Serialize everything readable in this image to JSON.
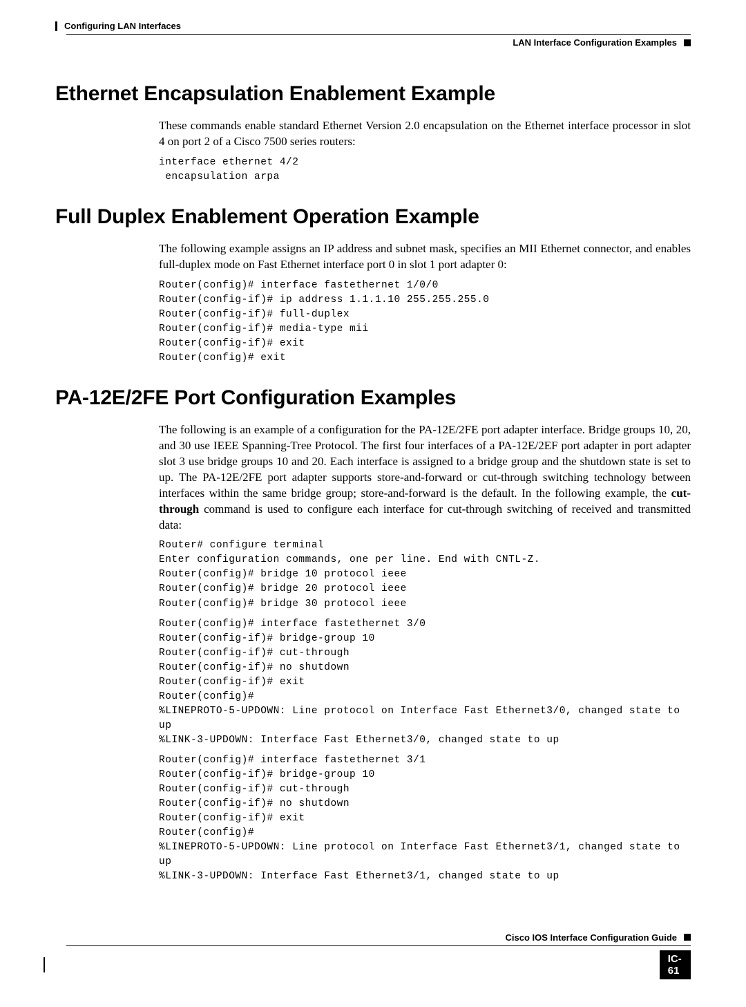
{
  "header": {
    "chapter": "Configuring LAN Interfaces",
    "section": "LAN Interface Configuration Examples"
  },
  "s1": {
    "title": "Ethernet Encapsulation Enablement Example",
    "p1": "These commands enable standard Ethernet Version 2.0 encapsulation on the Ethernet interface processor in slot 4 on port 2 of a Cisco 7500 series routers:",
    "code": {
      "l1": "interface ethernet 4/2",
      "l2": " encapsulation arpa"
    }
  },
  "s2": {
    "title": "Full Duplex Enablement Operation Example",
    "p1": "The following example assigns an IP address and subnet mask, specifies an MII Ethernet connector, and enables full-duplex mode on Fast Ethernet interface port 0 in slot 1 port adapter 0:",
    "code": {
      "l1a": "Router(config)# ",
      "l1b": "interface fastethernet 1/0/0",
      "l2a": "Router(config-if)# ",
      "l2b": "ip address 1.1.1.10 255.255.255.0",
      "l3a": "Router(config-if)# ",
      "l3b": "full-duplex",
      "l4a": "Router(config-if)# ",
      "l4b": "media-type mii",
      "l5a": "Router(config-if)# ",
      "l5b": "exit",
      "l6a": "Router(config)# ",
      "l6b": "exit"
    }
  },
  "s3": {
    "title": "PA-12E/2FE Port Configuration Examples",
    "p1a": "The following is an example of a configuration for the PA-12E/2FE port adapter interface. Bridge groups 10, 20, and 30 use IEEE Spanning-Tree Protocol. The first four interfaces of a PA-12E/2EF port adapter in port adapter slot 3 use bridge groups 10 and 20. Each interface is assigned to a bridge group and the shutdown state is set to up. The PA-12E/2FE port adapter supports store-and-forward or cut-through switching technology between interfaces within the same bridge group; store-and-forward is the default. In the following example, the ",
    "p1b": "cut-through",
    "p1c": " command is used to configure each interface for cut-through switching of received and transmitted data:",
    "blk1": {
      "l1a": "Router# ",
      "l1b": "configure terminal",
      "l2": "Enter configuration commands, one per line. End with CNTL-Z.",
      "l3a": "Router(config)# ",
      "l3b": "bridge 10 protocol ieee",
      "l4a": "Router(config)# ",
      "l4b": "bridge 20 protocol ieee",
      "l5a": "Router(config)# ",
      "l5b": "bridge 30 protocol ieee"
    },
    "blk2": {
      "l1a": "Router(config)# ",
      "l1b": "interface fastethernet 3/0",
      "l2a": "Router(config-if)# ",
      "l2b": "bridge-group 10",
      "l3a": "Router(config-if)# ",
      "l3b": "cut-through",
      "l4a": "Router(config-if)# ",
      "l4b": "no shutdown",
      "l5a": "Router(config-if)# ",
      "l5b": "exit",
      "l6": "Router(config)#",
      "l7": "%LINEPROTO-5-UPDOWN: Line protocol on Interface Fast Ethernet3/0, changed state to up",
      "l8": "%LINK-3-UPDOWN: Interface Fast Ethernet3/0, changed state to up"
    },
    "blk3": {
      "l1a": "Router(config)# ",
      "l1b": "interface fastethernet 3/1",
      "l2a": "Router(config-if)# ",
      "l2b": "bridge-group 10",
      "l3a": "Router(config-if)# ",
      "l3b": "cut-through",
      "l4a": "Router(config-if)# ",
      "l4b": "no shutdown",
      "l5a": "Router(config-if)# ",
      "l5b": "exit",
      "l6": "Router(config)#",
      "l7": "%LINEPROTO-5-UPDOWN: Line protocol on Interface Fast Ethernet3/1, changed state to up",
      "l8": "%LINK-3-UPDOWN: Interface Fast Ethernet3/1, changed state to up"
    }
  },
  "footer": {
    "guide": "Cisco IOS Interface Configuration Guide",
    "page": "IC-61"
  }
}
